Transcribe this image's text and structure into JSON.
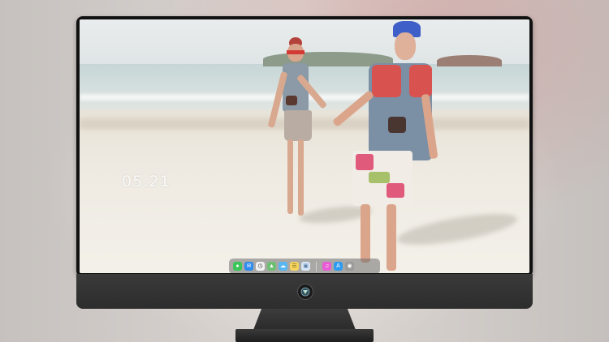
{
  "desktop": {
    "clock": "05:21"
  },
  "dock": {
    "icons": [
      {
        "name": "messages-icon",
        "color": "#3cc65a"
      },
      {
        "name": "mail-icon",
        "color": "#2e8bef"
      },
      {
        "name": "clock-app-icon",
        "color": "#f2f2f2"
      },
      {
        "name": "maps-icon",
        "color": "#6fbf73"
      },
      {
        "name": "weather-icon",
        "color": "#58b6f0"
      },
      {
        "name": "notes-icon",
        "color": "#f4d35e"
      },
      {
        "name": "photos-icon",
        "color": "#d9e6f5"
      },
      {
        "name": "itunes-icon",
        "color": "#e85bd4"
      },
      {
        "name": "app-store-icon",
        "color": "#2d9bf0"
      },
      {
        "name": "camera-icon",
        "color": "#9a9a9a"
      }
    ]
  },
  "colors": {
    "bezel": "#111111",
    "chin": "#333333"
  }
}
